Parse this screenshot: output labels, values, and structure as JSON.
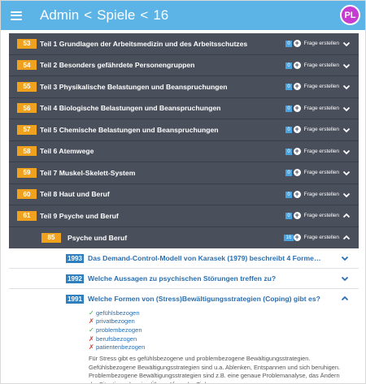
{
  "header": {
    "crumb_1": "Admin",
    "separator": "<",
    "crumb_2": "Spiele",
    "crumb_3": "16",
    "avatar_initials": "PL",
    "avatar_color": "#c63bd0",
    "bar_color": "#5bb3e6"
  },
  "create_label": "Frage erstellen",
  "categories": [
    {
      "num": "53",
      "title": "Teil 1 Grundlagen der Arbeitsmedizin und des Arbeitsschutzes",
      "count": "0"
    },
    {
      "num": "54",
      "title": "Teil 2 Besonders gefährdete Personengruppen",
      "count": "0"
    },
    {
      "num": "55",
      "title": "Teil 3 Physikalische Belastungen und Beanspruchungen",
      "count": "0"
    },
    {
      "num": "56",
      "title": "Teil 4 Biologische Belastungen und Beanspruchungen",
      "count": "0"
    },
    {
      "num": "57",
      "title": "Teil 5 Chemische Belastungen und Beanspruchungen",
      "count": "0"
    },
    {
      "num": "58",
      "title": "Teil 6 Atemwege",
      "count": "0"
    },
    {
      "num": "59",
      "title": "Teil 7 Muskel-Skelett-System",
      "count": "0"
    },
    {
      "num": "60",
      "title": "Teil 8 Haut und Beruf",
      "count": "0"
    },
    {
      "num": "61",
      "title": "Teil 9 Psyche und Beruf",
      "count": "0"
    }
  ],
  "subcategory": {
    "num": "85",
    "title": "Psyche und Beruf",
    "count": "16"
  },
  "questions": [
    {
      "num": "1993",
      "text": "Das Demand-Control-Modell von Karasek (1979) beschreibt 4 Formen der Arbei..."
    },
    {
      "num": "1992",
      "text": "Welche Aussagen zu psychischen Störungen treffen zu?"
    },
    {
      "num": "1991",
      "text": "Welche Formen von (Stress)Bewältigungsstrategien (Coping) gibt es?",
      "answers": [
        {
          "mark": "✓",
          "correct": true,
          "text": "gefühlsbezogen"
        },
        {
          "mark": "✗",
          "correct": false,
          "text": "privatbezogen"
        },
        {
          "mark": "✓",
          "correct": true,
          "text": "problembezogen"
        },
        {
          "mark": "✗",
          "correct": false,
          "text": "berufsbezogen"
        },
        {
          "mark": "✗",
          "correct": false,
          "text": "patientenbezogen"
        }
      ],
      "explanation": "Für Stress gibt es gefühlsbezogene und problembezogene Bewältigungsstrategien. Gefühlsbezogene Bewältigungsstrategien sind u.a. Ablenken, Entspannen und sich beruhigen. Problembezogene Bewältigungsstrategien sind z.B. eine genaue Problemanalyse, das Ändern der Situation oder eine Überprüfung der Ziele."
    }
  ]
}
